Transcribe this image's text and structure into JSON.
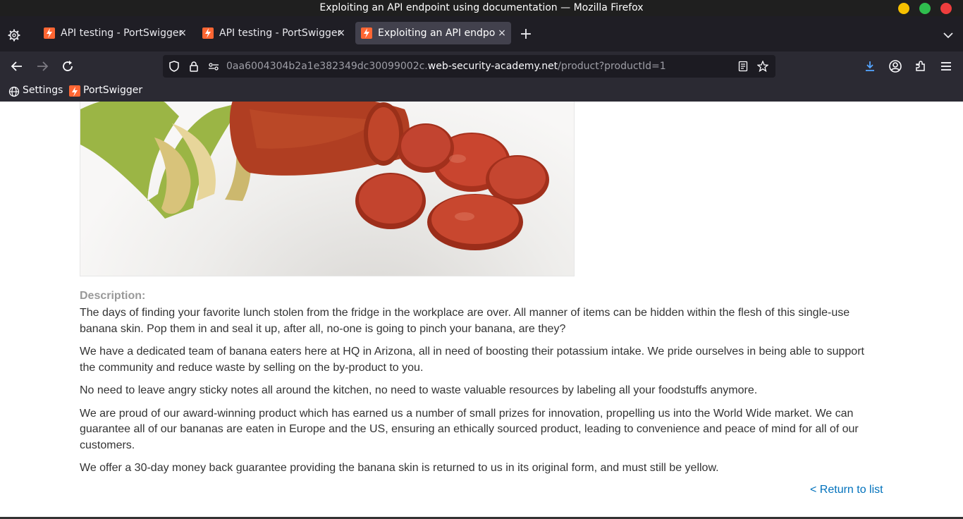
{
  "window": {
    "title": "Exploiting an API endpoint using documentation — Mozilla Firefox",
    "controls": {
      "minimize": "#f6c000",
      "maximize": "#2fbe4e",
      "close": "#ed3d3d"
    }
  },
  "tabs": [
    {
      "label": "API testing - PortSwigger",
      "active": false,
      "close": "×"
    },
    {
      "label": "API testing - PortSwigger",
      "active": false,
      "close": "×"
    },
    {
      "label": "Exploiting an API endpoint using documentation",
      "active": true,
      "close": "×"
    }
  ],
  "tab_new": "+",
  "urlbar": {
    "url_prefix": "0aa6004304b2a1e382349dc30099002c.",
    "url_domain": "web-security-academy.net",
    "url_path": "/product?productId=1"
  },
  "bookmarks": [
    {
      "label": "Settings",
      "icon": "globe-icon"
    },
    {
      "label": "PortSwigger",
      "icon": "portswigger-favicon"
    }
  ],
  "product": {
    "image_alt": "Banana skin filled with sliced sausage",
    "description_heading": "Description:",
    "paragraphs": [
      "The days of finding your favorite lunch stolen from the fridge in the workplace are over. All manner of items can be hidden within the flesh of this single-use banana skin. Pop them in and seal it up, after all, no-one is going to pinch your banana, are they?",
      "We have a dedicated team of banana eaters here at HQ in Arizona, all in need of boosting their potassium intake. We pride ourselves in being able to support the community and reduce waste by selling on the by-product to you.",
      "No need to leave angry sticky notes all around the kitchen, no need to waste valuable resources by labeling all your foodstuffs anymore.",
      "We are proud of our award-winning product which has earned us a number of small prizes for innovation, propelling us into the World Wide market. We can guarantee all of our bananas are eaten in Europe and the US, ensuring an ethically sourced product, leading to convenience and peace of mind for all of our customers.",
      "We offer a 30-day money back guarantee providing the banana skin is returned to us in its original form, and must still be yellow."
    ],
    "return_link": "< Return to list"
  },
  "colors": {
    "accent_link": "#0071bc",
    "favicon": "#ff6633",
    "download_active": "#54a5ff"
  }
}
